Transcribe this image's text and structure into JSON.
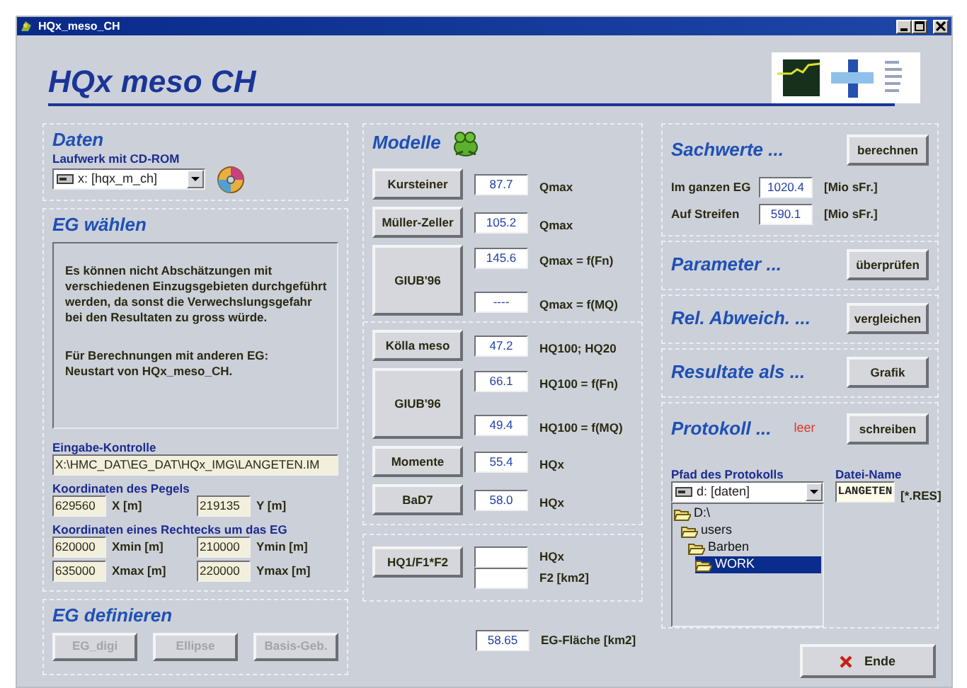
{
  "window": {
    "title": "HQx_meso_CH"
  },
  "header": {
    "title": "HQx meso CH"
  },
  "daten": {
    "heading": "Daten",
    "drive_label": "Laufwerk mit CD-ROM",
    "drive": "x: [hqx_m_ch]"
  },
  "eg_waehlen": {
    "heading": "EG wählen",
    "notes": [
      "Es können nicht Abschätzungen mit verschiedenen Einzugsgebieten durchgeführt werden, da sonst die Verwechslungsgefahr bei den Resultaten zu gross würde.",
      "Für Berechnungen mit anderen EG:\nNeustart von HQx_meso_CH."
    ],
    "input_label": "Eingabe-Kontrolle",
    "input_path": "X:\\HMC_DAT\\EG_DAT\\HQx_IMG\\LANGETEN.IM",
    "pegel_label": "Koordinaten des Pegels",
    "pegel": [
      {
        "value": "629560",
        "label": "X [m]"
      },
      {
        "value": "219135",
        "label": "Y [m]"
      }
    ],
    "rect_label": "Koordinaten eines Rechtecks um das EG",
    "rect": [
      {
        "value": "620000",
        "label": "Xmin [m]"
      },
      {
        "value": "210000",
        "label": "Ymin [m]"
      },
      {
        "value": "635000",
        "label": "Xmax [m]"
      },
      {
        "value": "220000",
        "label": "Ymax [m]"
      }
    ]
  },
  "eg_definieren": {
    "heading": "EG definieren",
    "buttons": [
      {
        "label": "EG_digi",
        "disabled": true
      },
      {
        "label": "Ellipse",
        "disabled": true
      },
      {
        "label": "Basis-Geb.",
        "disabled": true
      }
    ]
  },
  "modelle": {
    "heading": "Modelle",
    "sections": [
      {
        "groups": [
          {
            "button": "Kursteiner",
            "results": [
              {
                "value": "87.7",
                "label": "Qmax"
              }
            ]
          },
          {
            "button": "Müller-Zeller",
            "results": [
              {
                "value": "105.2",
                "label": "Qmax"
              }
            ]
          },
          {
            "button": "GIUB'96",
            "results": [
              {
                "value": "145.6",
                "label": "Qmax = f(Fn)"
              },
              {
                "value": "----",
                "label": "Qmax = f(MQ)"
              }
            ]
          }
        ]
      },
      {
        "groups": [
          {
            "button": "Kölla meso",
            "results": [
              {
                "value": "47.2",
                "label": "HQ100; HQ20"
              }
            ]
          },
          {
            "button": "GIUB'96",
            "results": [
              {
                "value": "66.1",
                "label": "HQ100 = f(Fn)"
              },
              {
                "value": "49.4",
                "label": "HQ100 = f(MQ)"
              }
            ]
          },
          {
            "button": "Momente",
            "results": [
              {
                "value": "55.4",
                "label": "HQx"
              }
            ]
          },
          {
            "button": "BaD7",
            "results": [
              {
                "value": "58.0",
                "label": "HQx"
              }
            ]
          }
        ]
      }
    ]
  },
  "hq_f": {
    "button": "HQ1/F1*F2",
    "results": [
      {
        "label": "HQx"
      },
      {
        "label": "F2 [km2]"
      }
    ]
  },
  "area": {
    "value": "58.65",
    "label": "EG-Fläche [km2]"
  },
  "sachwerte": {
    "heading": "Sachwerte ...",
    "button": "berechnen",
    "rows": [
      {
        "label": "Im ganzen EG",
        "value": "1020.4",
        "unit": "[Mio sFr.]"
      },
      {
        "label": "Auf Streifen",
        "value": "590.1",
        "unit": "[Mio sFr.]"
      }
    ]
  },
  "actions": [
    {
      "heading": "Parameter ...",
      "button": "überprüfen"
    },
    {
      "heading": "Rel. Abweich. ...",
      "button": "vergleichen"
    },
    {
      "heading": "Resultate als ...",
      "button": "Grafik"
    }
  ],
  "protokoll": {
    "heading": "Protokoll ...",
    "status": "leer",
    "button": "schreiben",
    "path_label": "Pfad des Protokolls",
    "drive": "d: [daten]",
    "file_label": "Datei-Name",
    "file_name": "LANGETEN",
    "file_ext": "[*.RES]",
    "folders": [
      {
        "name": "D:\\",
        "selected": false,
        "children": [
          {
            "name": "users",
            "selected": false,
            "children": [
              {
                "name": "Barben",
                "selected": false,
                "children": [
                  {
                    "name": "WORK",
                    "selected": true
                  }
                ]
              }
            ]
          }
        ]
      }
    ]
  },
  "exit_button": "Ende"
}
